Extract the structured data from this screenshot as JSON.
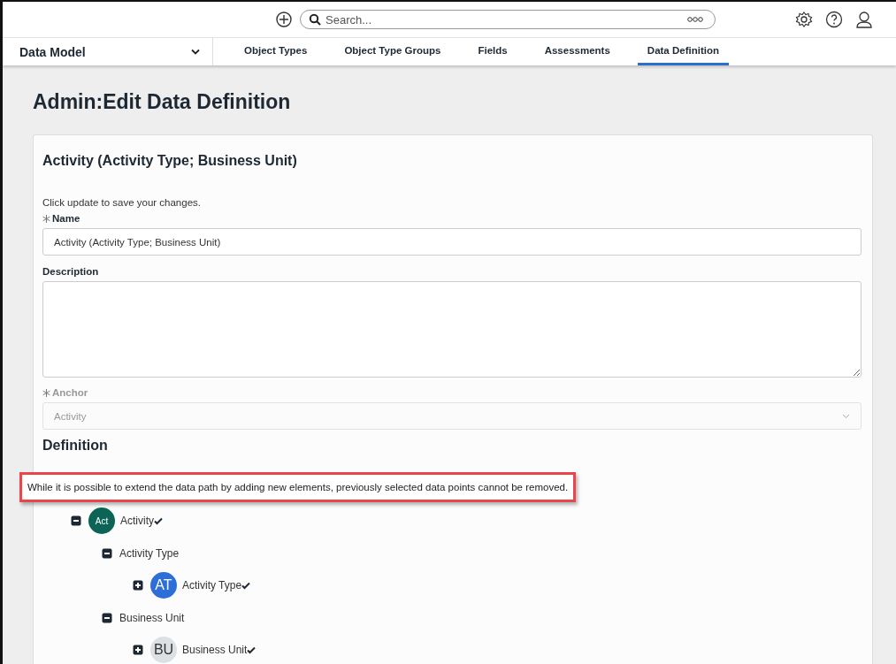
{
  "topbar": {
    "search": {
      "placeholder": "Search..."
    }
  },
  "nav": {
    "module": "Data Model",
    "tabs": [
      {
        "label": "Object Types",
        "selected": false
      },
      {
        "label": "Object Type Groups",
        "selected": false
      },
      {
        "label": "Fields",
        "selected": false
      },
      {
        "label": "Assessments",
        "selected": false
      },
      {
        "label": "Data Definition",
        "selected": true
      }
    ]
  },
  "page_title": {
    "prefix": "Admin",
    "separator": ":",
    "title": "Edit Data Definition"
  },
  "card": {
    "heading": "Activity (Activity Type; Business Unit)",
    "hint": "Click update to save your changes.",
    "name": {
      "label": "Name",
      "required": true,
      "value": "Activity (Activity Type; Business Unit)"
    },
    "description": {
      "label": "Description",
      "required": false
    },
    "anchor": {
      "label": "Anchor",
      "required": true,
      "value": "Activity",
      "disabled": true
    },
    "definition_heading": "Definition",
    "callout": "While it is possible to extend the data path by adding new elements, previously selected data points cannot be removed.",
    "tree": [
      {
        "kind": "object",
        "badge": "Act",
        "label": "Activity",
        "color": "#0b6456",
        "checked": true,
        "expanded": true,
        "children": [
          {
            "kind": "relation",
            "label": "Activity Type",
            "expanded": true,
            "children": [
              {
                "kind": "object",
                "badge": "AT",
                "label": "Activity Type",
                "color": "#2d6fd6",
                "checked": true,
                "expanded": false
              }
            ]
          },
          {
            "kind": "relation",
            "label": "Business Unit",
            "expanded": true,
            "children": [
              {
                "kind": "object",
                "badge": "BU",
                "label": "Business Unit",
                "color": "#dde0e3",
                "checked": true,
                "expanded": false
              }
            ]
          }
        ]
      }
    ]
  }
}
